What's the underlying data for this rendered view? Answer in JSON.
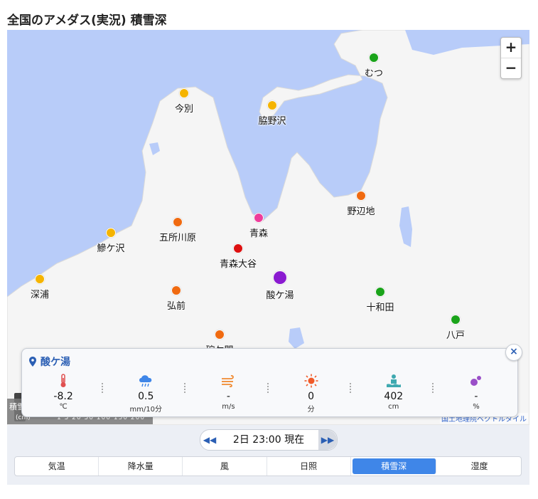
{
  "page": {
    "title": "全国のアメダス(実況) 積雪深"
  },
  "zoom": {
    "in_label": "+",
    "out_label": "−"
  },
  "colors": {
    "sea": "#b8ccf9",
    "land": "#f5f5f5",
    "accent": "#3f86e8",
    "popup_title": "#2b5fb4"
  },
  "stations": [
    {
      "name": "むつ",
      "color": "#1aa31a"
    },
    {
      "name": "今別",
      "color": "#f5b400"
    },
    {
      "name": "脇野沢",
      "color": "#f5b400"
    },
    {
      "name": "野辺地",
      "color": "#f06a10"
    },
    {
      "name": "青森",
      "color": "#ee3d9b"
    },
    {
      "name": "五所川原",
      "color": "#f06a10"
    },
    {
      "name": "鰺ケ沢",
      "color": "#f5b400"
    },
    {
      "name": "青森大谷",
      "color": "#dd1010"
    },
    {
      "name": "酸ケ湯",
      "color": "#8a1ad0"
    },
    {
      "name": "深浦",
      "color": "#f5b400"
    },
    {
      "name": "弘前",
      "color": "#f06a10"
    },
    {
      "name": "十和田",
      "color": "#1aa31a"
    },
    {
      "name": "八戸",
      "color": "#1aa31a"
    },
    {
      "name": "碇ケ関",
      "color": "#f06a10"
    }
  ],
  "legend": {
    "label": "積雪",
    "unit": "(cm)",
    "ticks": "1  5  20  50  100 150 200"
  },
  "attribution": "国土地理院ベクトルタイル",
  "popup": {
    "station": "酸ケ湯",
    "close_label": "×",
    "metrics": [
      {
        "icon": "thermometer-icon",
        "value": "-8.2",
        "unit": "℃"
      },
      {
        "icon": "rain-cloud-icon",
        "value": "0.5",
        "unit": "mm/10分"
      },
      {
        "icon": "wind-icon",
        "value": "-",
        "unit": "m/s"
      },
      {
        "icon": "sun-icon",
        "value": "0",
        "unit": "分"
      },
      {
        "icon": "snow-depth-icon",
        "value": "402",
        "unit": "cm"
      },
      {
        "icon": "humidity-icon",
        "value": "-",
        "unit": "%"
      }
    ]
  },
  "time_nav": {
    "prev_label": "◀◀",
    "next_label": "▶▶",
    "time": "2日 23:00 現在"
  },
  "tabs": [
    {
      "label": "気温",
      "active": false
    },
    {
      "label": "降水量",
      "active": false
    },
    {
      "label": "風",
      "active": false
    },
    {
      "label": "日照",
      "active": false
    },
    {
      "label": "積雪深",
      "active": true
    },
    {
      "label": "湿度",
      "active": false
    }
  ]
}
